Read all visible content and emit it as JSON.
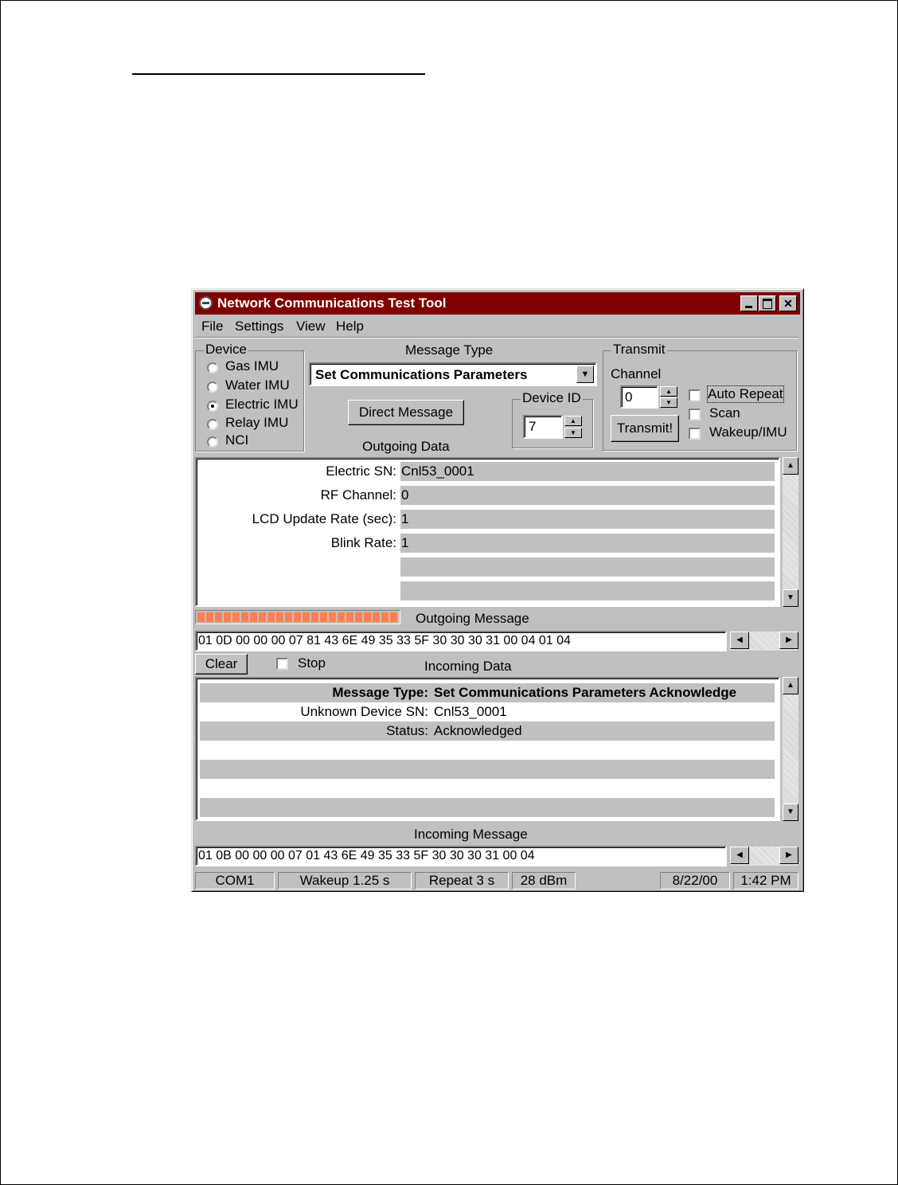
{
  "window": {
    "title": "Network Communications Test Tool",
    "title_bar_color": "#800000",
    "buttons": {
      "minimize": "_",
      "maximize": "□",
      "close": "✕"
    }
  },
  "menu": {
    "file": "File",
    "settings": "Settings",
    "view": "View",
    "help": "Help"
  },
  "device": {
    "group_label": "Device",
    "options": [
      "Gas IMU",
      "Water IMU",
      "Electric IMU",
      "Relay IMU",
      "NCI"
    ],
    "selected": "Electric IMU"
  },
  "message_type": {
    "label": "Message Type",
    "selected": "Set Communications Parameters",
    "direct_message_button": "Direct Message",
    "device_id_label": "Device ID",
    "device_id_value": "7"
  },
  "transmit": {
    "group_label": "Transmit",
    "channel_label": "Channel",
    "channel_value": "0",
    "transmit_button": "Transmit!",
    "auto_repeat": "Auto Repeat",
    "scan": "Scan",
    "wakeup": "Wakeup/IMU"
  },
  "outgoing_data": {
    "label": "Outgoing Data",
    "rows": [
      {
        "label": "Electric SN:",
        "value": "Cnl53_0001"
      },
      {
        "label": "RF Channel:",
        "value": "0"
      },
      {
        "label": "LCD Update Rate (sec):",
        "value": "1"
      },
      {
        "label": "Blink Rate:",
        "value": "1"
      },
      {
        "label": "",
        "value": ""
      },
      {
        "label": "",
        "value": ""
      }
    ]
  },
  "outgoing_message": {
    "label": "Outgoing Message",
    "progress": 1.0,
    "progress_color": "#ff7f50",
    "hex": "01 0D 00 00 00 07 81 43 6E 49 35 33 5F 30 30 30 31 00 04 01 04"
  },
  "incoming_controls": {
    "clear_button": "Clear",
    "stop": "Stop"
  },
  "incoming_data": {
    "label": "Incoming Data",
    "header_label": "Message Type:",
    "header_value": "Set Communications Parameters Acknowledge",
    "rows": [
      {
        "label": "Unknown Device SN:",
        "value": "Cnl53_0001"
      },
      {
        "label": "Status:",
        "value": "Acknowledged"
      },
      {
        "label": "",
        "value": ""
      },
      {
        "label": "",
        "value": ""
      },
      {
        "label": "",
        "value": ""
      },
      {
        "label": "",
        "value": ""
      }
    ]
  },
  "incoming_message": {
    "label": "Incoming Message",
    "hex": "01 0B 00 00 00 07 01 43 6E 49 35 33 5F 30 30 30 31 00 04"
  },
  "status_bar": {
    "port": "COM1",
    "wakeup": "Wakeup 1.25 s",
    "repeat": "Repeat 3 s",
    "power": "28 dBm",
    "date": "8/22/00",
    "time": "1:42 PM"
  }
}
